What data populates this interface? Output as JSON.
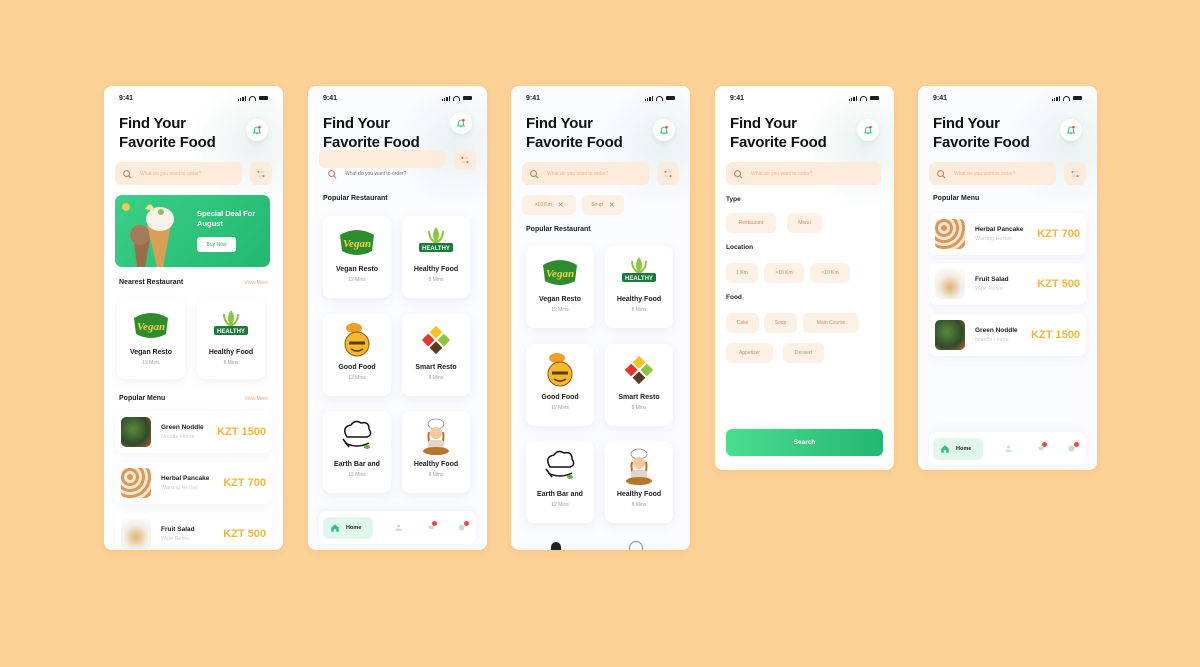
{
  "status_time": "9:41",
  "header_title_line1": "Find Your",
  "header_title_line2": "Favorite Food",
  "search_placeholder": "What do you want to order?",
  "colors": {
    "background": "#fcd196",
    "accent_green": "#22b86f",
    "price_yellow": "#f4b63a",
    "chip_bg": "#fdf0e4",
    "chip_text": "#e0895a",
    "notification_red": "#f0483e"
  },
  "icons": {
    "notification": "bell-icon",
    "search": "search-icon",
    "filter": "filter-icon",
    "home": "home-icon",
    "profile": "profile-icon",
    "cart": "cart-icon",
    "chat": "chat-icon"
  },
  "screen1": {
    "promo": {
      "title": "Special Deal For August",
      "button": "Buy Now"
    },
    "nearest": {
      "heading": "Nearest Restaurant",
      "more": "View More"
    },
    "restaurants": [
      {
        "name": "Vegan Resto",
        "time": "12 Mins",
        "logo": "vegan"
      },
      {
        "name": "Healthy Food",
        "time": "8 Mins",
        "logo": "healthy"
      }
    ],
    "popular": {
      "heading": "Popular Menu",
      "more": "View More"
    },
    "menu": [
      {
        "name": "Green Noddle",
        "place": "Noodle Home",
        "price": "KZT 1500"
      },
      {
        "name": "Herbal Pancake",
        "place": "Warung Herbal",
        "price": "KZT 700"
      },
      {
        "name": "Fruit Salad",
        "place": "Wijie Resto",
        "price": "KZT 500"
      }
    ]
  },
  "screen2": {
    "heading": "Popular Restaurant",
    "restaurants": [
      {
        "name": "Vegan Resto",
        "time": "12 Mins"
      },
      {
        "name": "Healthy Food",
        "time": "8 Mins"
      },
      {
        "name": "Good Food",
        "time": "12 Mins"
      },
      {
        "name": "Smart Resto",
        "time": "8 Mins"
      },
      {
        "name": "Earth Bar and",
        "time": "12 Mins"
      },
      {
        "name": "Healthy Food",
        "time": "8 Mins"
      }
    ],
    "nav": {
      "home": "Home"
    }
  },
  "screen3": {
    "chips": [
      {
        "label": ">10 Km"
      },
      {
        "label": "Soup"
      }
    ],
    "heading": "Popular Restaurant",
    "restaurants": [
      {
        "name": "Vegan Resto",
        "time": "12 Mins"
      },
      {
        "name": "Healthy Food",
        "time": "8 Mins"
      },
      {
        "name": "Good Food",
        "time": "12 Mins"
      },
      {
        "name": "Smart Resto",
        "time": "8 Mins"
      },
      {
        "name": "Earth Bar and",
        "time": "12 Mins"
      },
      {
        "name": "Healthy Food",
        "time": "8 Mins"
      }
    ]
  },
  "screen4": {
    "type_label": "Type",
    "type_options": [
      "Restaurant",
      "Menu"
    ],
    "location_label": "Location",
    "location_options": [
      "1 Km",
      ">10 Km",
      "<10 Km"
    ],
    "food_label": "Food",
    "food_options": [
      "Cake",
      "Soup",
      "Main Course",
      "Appetizer",
      "Dessert"
    ],
    "search_button": "Search"
  },
  "screen5": {
    "heading": "Popular Menu",
    "menu": [
      {
        "name": "Herbal Pancake",
        "place": "Warung Herbal",
        "price": "KZT 700"
      },
      {
        "name": "Fruit Salad",
        "place": "Wijie Resto",
        "price": "KZT 500"
      },
      {
        "name": "Green Noddle",
        "place": "Noodle Home",
        "price": "KZT 1500"
      }
    ],
    "nav": {
      "home": "Home"
    }
  }
}
